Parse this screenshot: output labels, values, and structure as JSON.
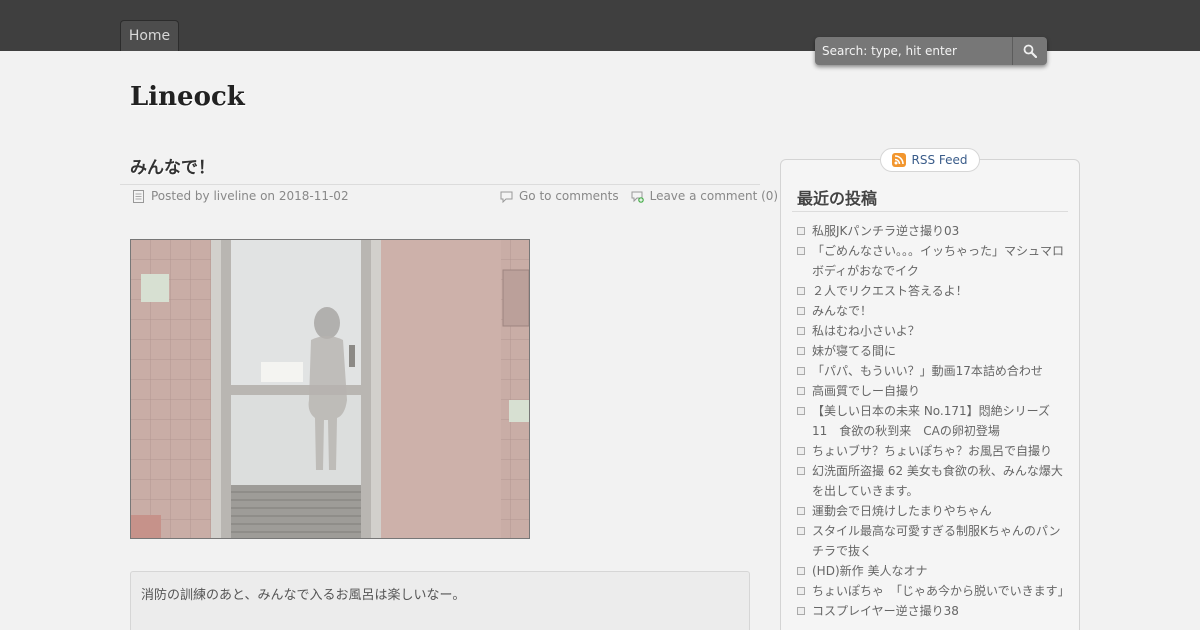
{
  "nav": {
    "home_label": "Home"
  },
  "search": {
    "placeholder": "Search: type, hit enter"
  },
  "site": {
    "title": "Lineock"
  },
  "post": {
    "title": "みんなで！",
    "posted_by": "Posted by liveline on 2018-11-02",
    "go_to_comments": "Go to comments",
    "leave_comment": "Leave a comment (0)",
    "excerpt": "消防の訓練のあと、みんなで入るお風呂は楽しいなー。"
  },
  "sidebar": {
    "rss_label": "RSS Feed",
    "widget_title": "最近の投稿",
    "recent_posts": [
      "私服JKパンチラ逆さ撮り03",
      "「ごめんなさい。。。イッちゃった」マシュマロボディがおなでイク",
      "２人でリクエスト答えるよ！",
      "みんなで！",
      "私はむね小さいよ？",
      "妹が寝てる間に",
      "「パパ、もういい？」動画17本詰め合わせ",
      "高画質でしー自撮り",
      "【美しい日本の未来 No.171】悶絶シリーズ11　食欲の秋到来　CAの卵初登場",
      "ちょいブサ？ちょいぽちゃ？お風呂で自撮り",
      "幻洗面所盗撮 62 美女も食欲の秋、みんな爆大を出していきます。",
      "運動会で日焼けしたまりやちゃん",
      "スタイル最高な可愛すぎる制服Kちゃんのパンチラで抜く",
      "(HD)新作 美人なオナ",
      "ちょいぽちゃ　「じゃあ今から脱いでいきます」",
      "コスプレイヤー逆さ撮り38"
    ]
  },
  "colors": {
    "topbar": "#3f3f3f",
    "page_bg": "#f2f2f2",
    "link_blue": "#3a5c8a"
  }
}
